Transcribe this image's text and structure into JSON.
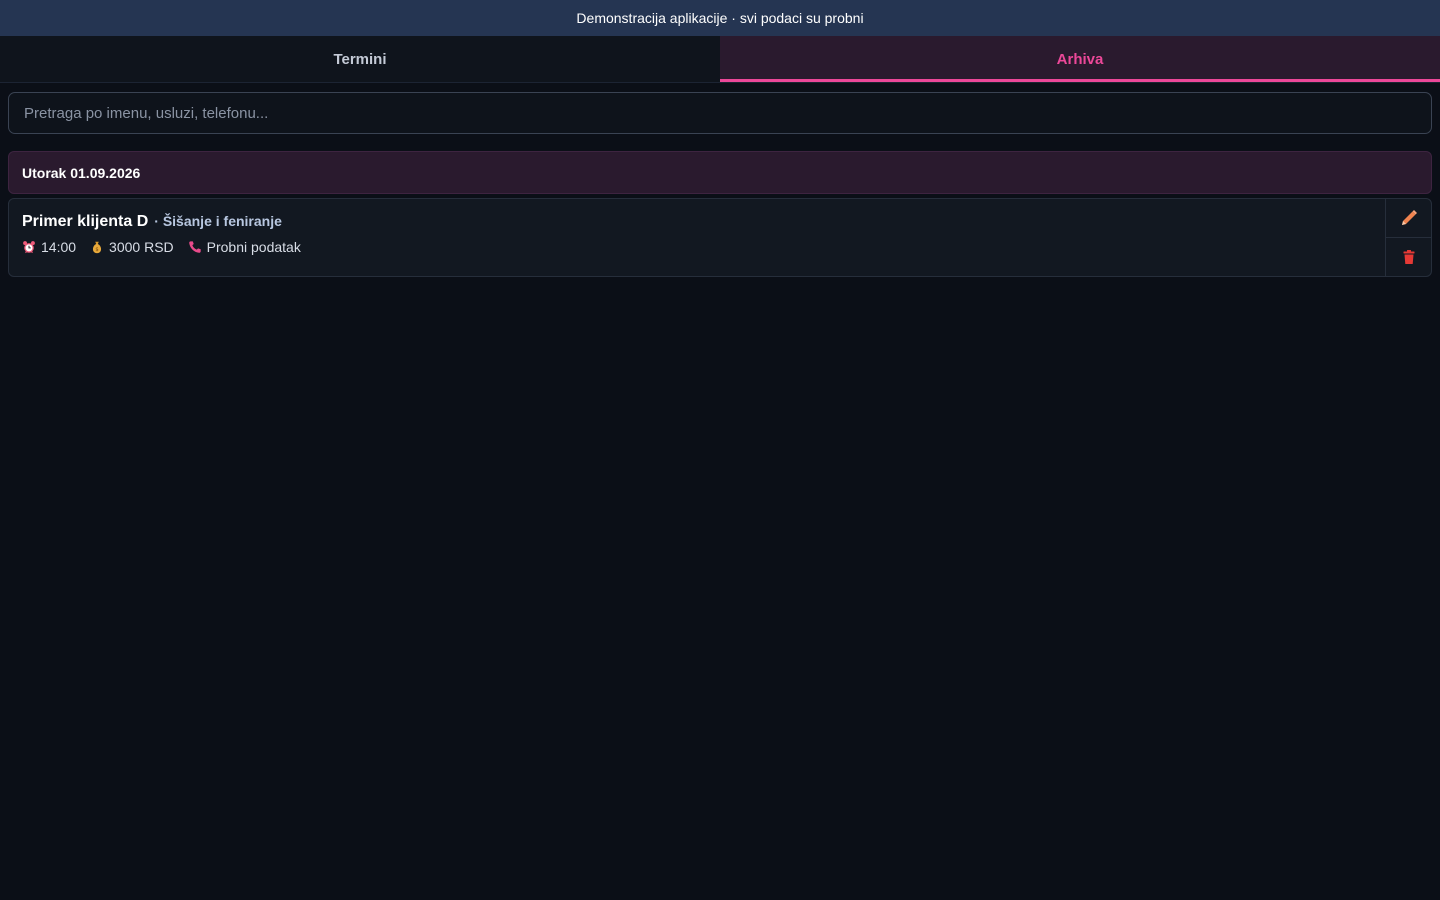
{
  "banner": {
    "text": "Demonstracija aplikacije · svi podaci su probni"
  },
  "tabs": [
    {
      "label": "Termini",
      "active": false
    },
    {
      "label": "Arhiva",
      "active": true
    }
  ],
  "search": {
    "placeholder": "Pretraga po imenu, usluzi, telefonu...",
    "value": ""
  },
  "groups": [
    {
      "date_label": "Utorak 01.09.2026",
      "appointments": [
        {
          "client": "Primer klijenta D",
          "service": "· Šišanje i feniranje",
          "time": "14:00",
          "price": "3000 RSD",
          "phone": "Probni podatak",
          "icons": {
            "time": "alarm-clock-icon",
            "price": "money-bag-icon",
            "phone": "phone-icon",
            "edit": "pencil-icon",
            "delete": "trash-icon"
          }
        }
      ]
    }
  ],
  "colors": {
    "accent": "#ec4899",
    "banner_bg": "#253552",
    "background": "#0b0f17",
    "edit_icon": "#f0834f",
    "delete_icon": "#e53935"
  }
}
